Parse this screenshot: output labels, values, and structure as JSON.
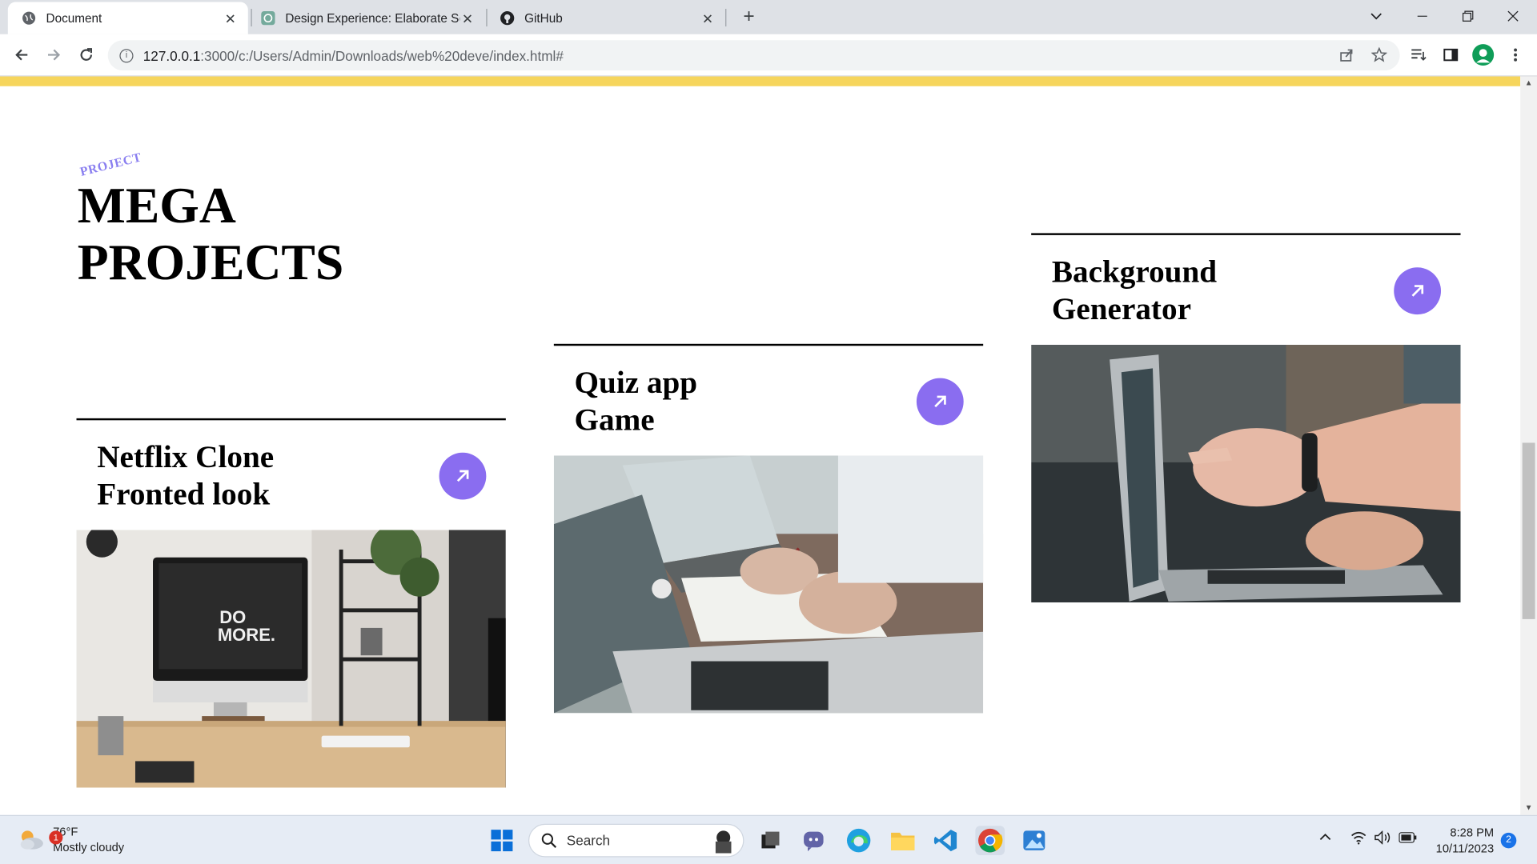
{
  "browser": {
    "tabs": [
      {
        "title": "Document",
        "active": true
      },
      {
        "title": "Design Experience: Elaborate Se",
        "active": false
      },
      {
        "title": "GitHub",
        "active": false
      }
    ],
    "url": {
      "host": "127.0.0.1",
      "path": ":3000/c:/Users/Admin/Downloads/web%20deve/index.html#"
    }
  },
  "page": {
    "kicker": "PROJECT",
    "headline": [
      "MEGA",
      "PROJECTS"
    ],
    "accent_color": "#8a6df0",
    "projects": [
      {
        "title": [
          "Netflix Clone",
          "Fronted look"
        ],
        "image": "desk-imac-do-more"
      },
      {
        "title": [
          "Quiz app",
          "Game"
        ],
        "image": "laptops-hands-writing"
      },
      {
        "title": [
          "Background",
          "Generator"
        ],
        "image": "hand-pointing-laptop"
      }
    ]
  },
  "taskbar": {
    "weather": {
      "temp": "76°F",
      "condition": "Mostly cloudy",
      "badge": "1"
    },
    "search_placeholder": "Search",
    "time": "8:28 PM",
    "date": "10/11/2023",
    "notifications": "2"
  }
}
